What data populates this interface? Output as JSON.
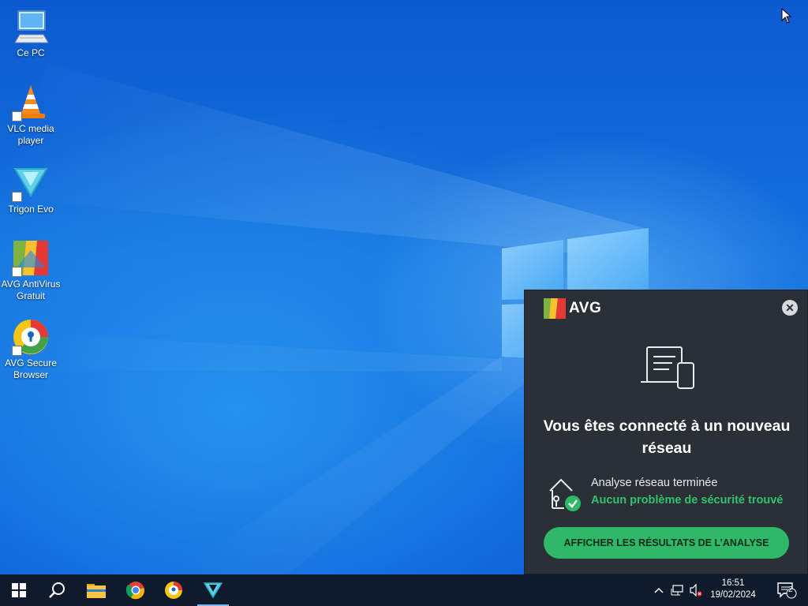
{
  "desktop": {
    "icons": [
      {
        "label": "Ce PC",
        "icon": "this-pc-icon"
      },
      {
        "label": "VLC media player",
        "icon": "vlc-icon"
      },
      {
        "label": "Trigon Evo",
        "icon": "trigon-evo-icon"
      },
      {
        "label": "AVG AntiVirus Gratuit",
        "icon": "avg-antivirus-icon"
      },
      {
        "label": "AVG Secure Browser",
        "icon": "avg-secure-browser-icon"
      }
    ]
  },
  "popup": {
    "brand": "AVG",
    "close": "✕",
    "title": "Vous êtes connecté à un nouveau réseau",
    "status_line1": "Analyse réseau terminée",
    "status_line2": "Aucun problème de sécurité trouvé",
    "button": "AFFICHER LES RÉSULTATS DE L’ANALYSE",
    "accent_color": "#2fb868"
  },
  "taskbar": {
    "items": [
      "start-icon",
      "search-icon",
      "file-explorer-icon",
      "chrome-icon",
      "avg-secure-browser-icon",
      "trigon-evo-icon"
    ],
    "clock_time": "16:51",
    "clock_date": "19/02/2024",
    "notification_count": "2"
  }
}
